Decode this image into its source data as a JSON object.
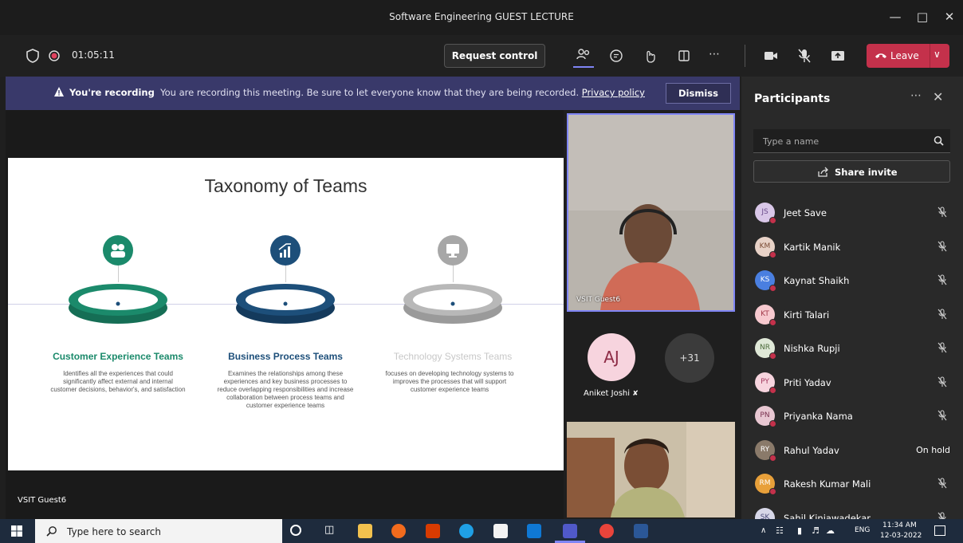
{
  "window": {
    "title": "Software Engineering GUEST LECTURE",
    "minimize_icon": "minimize-icon",
    "maximize_icon": "maximize-icon",
    "close_icon": "close-icon"
  },
  "toolbar": {
    "timer": "01:05:11",
    "request_control_label": "Request control",
    "leave_label": "Leave",
    "icons": [
      "shield-icon",
      "recording-dot-icon",
      "participants-icon",
      "chat-icon",
      "reactions-icon",
      "rooms-icon",
      "more-icon",
      "camera-icon",
      "mic-muted-icon",
      "share-tray-icon",
      "phone-icon",
      "chevron-down-icon"
    ]
  },
  "banner": {
    "bold_text": "You're recording",
    "text": "You are recording this meeting. Be sure to let everyone know that they are being recorded.",
    "link_text": "Privacy policy",
    "dismiss_label": "Dismiss"
  },
  "slide": {
    "title": "Taxonomy of Teams",
    "teams": [
      {
        "title": "Customer Experience Teams",
        "description": "Identifies all the experiences that could significantly affect external and internal customer decisions, behavior's, and satisfaction",
        "color": "#1b8a6b",
        "icon": "people-icon"
      },
      {
        "title": "Business Process Teams",
        "description": "Examines the relationships among these experiences and key business processes to reduce overlapping responsibilities and increase collaboration between process teams and customer experience teams",
        "color": "#1d4f7a",
        "icon": "growth-chart-icon"
      },
      {
        "title": "Technology Systems Teams",
        "description": "focuses on developing technology systems to improves the processes that will support customer experience teams",
        "color": "#b0b0b0",
        "icon": "monitor-icon"
      }
    ]
  },
  "stage": {
    "presenter_name": "VSIT Guest6"
  },
  "videos": {
    "main_label": "VSIT Guest6",
    "avatar_initials": "AJ",
    "avatar_name": "Aniket Joshi",
    "overflow_count": "+31"
  },
  "participants": {
    "title": "Participants",
    "search_placeholder": "Type a name",
    "share_invite_label": "Share invite",
    "list": [
      {
        "initials": "JS",
        "name": "Jeet Save",
        "status": "",
        "color": "#d9c7e8",
        "text_color": "#6b4c8a"
      },
      {
        "initials": "KM",
        "name": "Kartik Manik",
        "status": "",
        "color": "#e8d2c7",
        "text_color": "#7a4a33"
      },
      {
        "initials": "KS",
        "name": "Kaynat Shaikh",
        "status": "",
        "color": "#4a7fe0",
        "text_color": "#ffffff"
      },
      {
        "initials": "KT",
        "name": "Kirti Talari",
        "status": "",
        "color": "#f7c9cf",
        "text_color": "#a33c4c"
      },
      {
        "initials": "NR",
        "name": "Nishka Rupji",
        "status": "",
        "color": "#dfe8d7",
        "text_color": "#4b6b3a"
      },
      {
        "initials": "PY",
        "name": "Priti Yadav",
        "status": "",
        "color": "#f7d4de",
        "text_color": "#a33c60"
      },
      {
        "initials": "PN",
        "name": "Priyanka Nama",
        "status": "",
        "color": "#e8c7d2",
        "text_color": "#7a3350"
      },
      {
        "initials": "RY",
        "name": "Rahul Yadav",
        "status": "On hold",
        "color": "#8a7a6a",
        "text_color": "#ffffff"
      },
      {
        "initials": "RM",
        "name": "Rakesh Kumar Mali",
        "status": "",
        "color": "#e8a03a",
        "text_color": "#ffffff"
      },
      {
        "initials": "SK",
        "name": "Sahil Kiniawadekar",
        "status": "",
        "color": "#d7d7e8",
        "text_color": "#4b4b7a"
      }
    ]
  },
  "taskbar": {
    "search_placeholder": "Type here to search",
    "language": "ENG",
    "time": "11:34 AM",
    "date": "12-03-2022"
  }
}
